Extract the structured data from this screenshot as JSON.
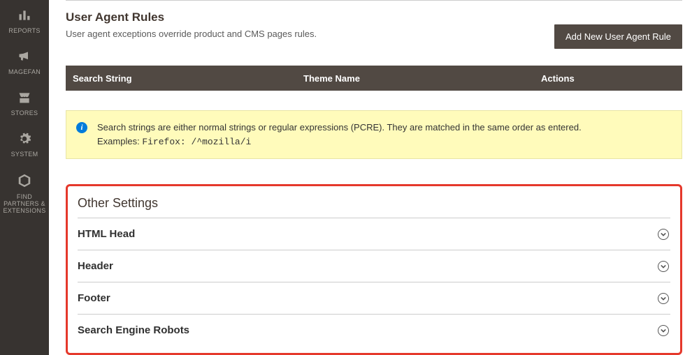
{
  "sidebar": {
    "items": [
      {
        "label": "REPORTS"
      },
      {
        "label": "MAGEFAN"
      },
      {
        "label": "STORES"
      },
      {
        "label": "SYSTEM"
      },
      {
        "label": "FIND PARTNERS & EXTENSIONS"
      }
    ]
  },
  "userAgent": {
    "title": "User Agent Rules",
    "subtitle": "User agent exceptions override product and CMS pages rules.",
    "addButton": "Add New User Agent Rule",
    "columns": {
      "search": "Search String",
      "theme": "Theme Name",
      "actions": "Actions"
    },
    "infoLine1": "Search strings are either normal strings or regular expressions (PCRE). They are matched in the same order as entered.",
    "infoExamplesLabel": "Examples: ",
    "infoExampleCode": "Firefox: /^mozilla/i"
  },
  "otherSettings": {
    "title": "Other Settings",
    "rows": [
      {
        "label": "HTML Head"
      },
      {
        "label": "Header"
      },
      {
        "label": "Footer"
      },
      {
        "label": "Search Engine Robots"
      }
    ]
  }
}
